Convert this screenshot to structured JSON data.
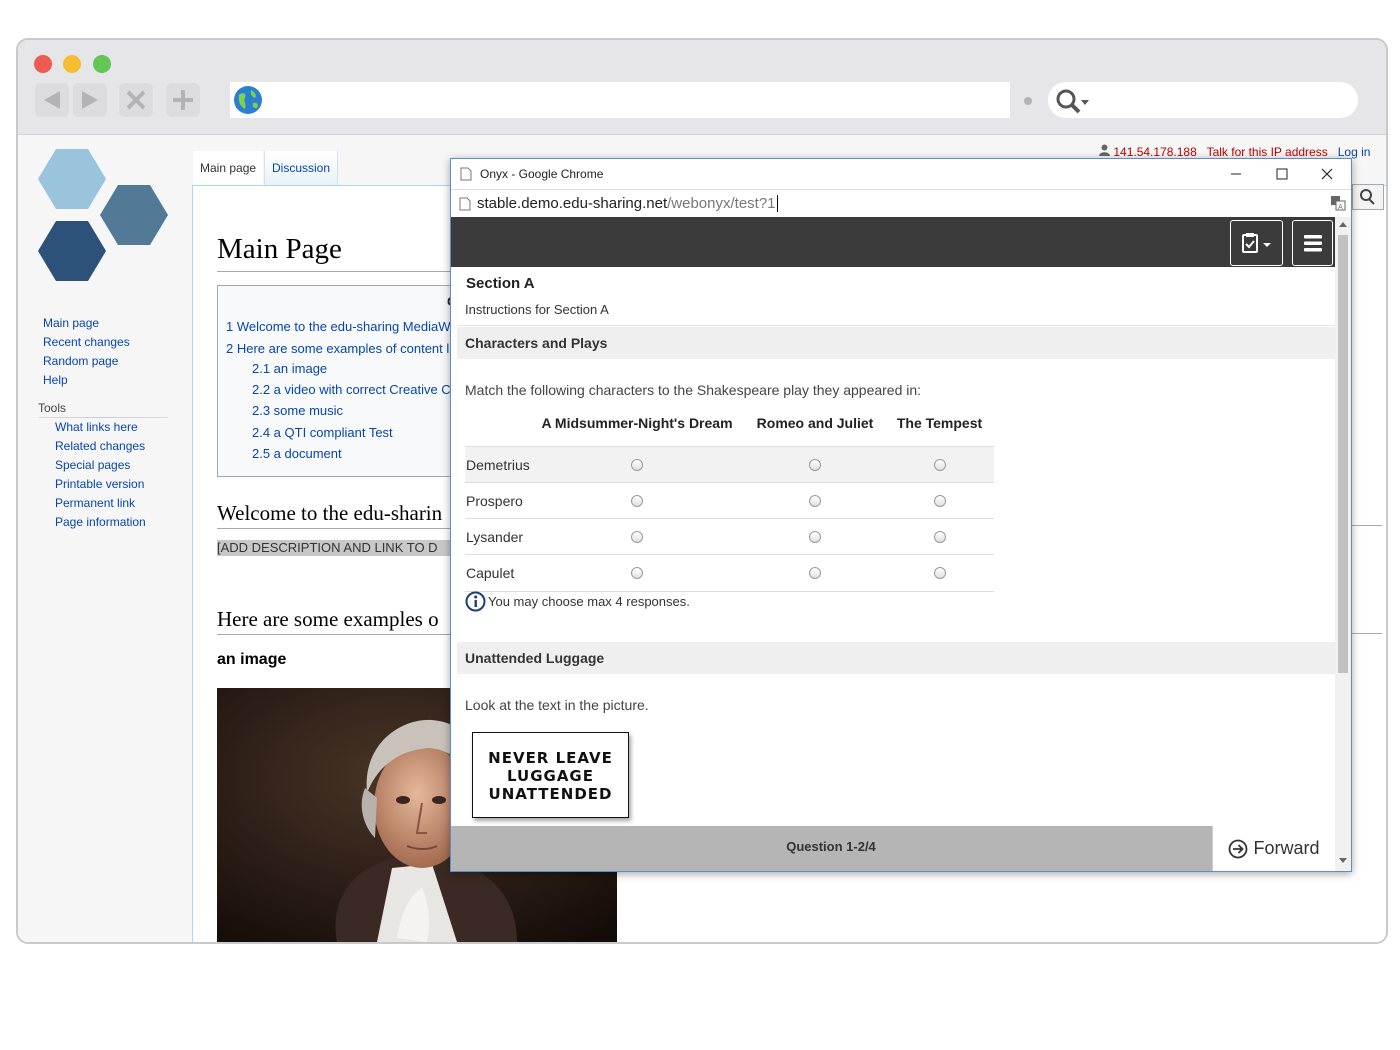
{
  "wiki": {
    "user_ip": "141.54.178.188",
    "talk_link": "Talk for this IP address",
    "login_link": "Log in",
    "tabs": [
      "Main page",
      "Discussion"
    ],
    "sidebar": {
      "nav": [
        "Main page",
        "Recent changes",
        "Random page",
        "Help"
      ],
      "tools_heading": "Tools",
      "tools": [
        "What links here",
        "Related changes",
        "Special pages",
        "Printable version",
        "Permanent link",
        "Page information"
      ]
    },
    "page_title": "Main Page",
    "toc_letter": "C",
    "toc": [
      "1 Welcome to the edu-sharing MediaW",
      "2 Here are some examples of content l",
      "2.1 an image",
      "2.2 a video with correct Creative C",
      "2.3 some music",
      "2.4 a QTI compliant Test",
      "2.5 a document"
    ],
    "heading_welcome": "Welcome to the edu-sharin",
    "desc_placeholder": "[ADD DESCRIPTION AND LINK TO D",
    "heading_examples": "Here are some examples o",
    "subheading_image": "an image"
  },
  "popup": {
    "window_title": "Onyx - Google Chrome",
    "url_host": "stable.demo.edu-sharing.net",
    "url_path": "/webonyx/test?1",
    "section_title": "Section A",
    "section_instructions": "Instructions for Section A",
    "q1": {
      "title": "Characters and Plays",
      "prompt": "Match the following characters to the Shakespeare play they appeared in:",
      "columns": [
        "A Midsummer-Night's Dream",
        "Romeo and Juliet",
        "The Tempest"
      ],
      "rows": [
        "Demetrius",
        "Prospero",
        "Lysander",
        "Capulet"
      ],
      "hint": "You may choose max 4 responses."
    },
    "q2": {
      "title": "Unattended Luggage",
      "prompt": "Look at the text in the picture.",
      "sign_text": [
        "NEVER LEAVE",
        "LUGGAGE",
        "UNATTENDED"
      ]
    },
    "footer_progress": "Question 1-2/4",
    "forward_label": "Forward"
  }
}
